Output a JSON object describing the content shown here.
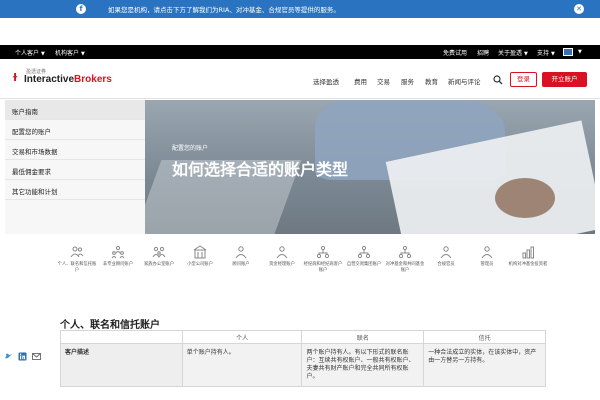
{
  "banner": {
    "icon": "ib-logo-icon",
    "text": "如果您是机构，请点击下方了解我们为RIA、对冲基金、合规官员等提供的服务。",
    "close_icon": "close-icon",
    "bg_color": "#2a73c0"
  },
  "utilbar": {
    "personal": "个人客户",
    "institutional": "机构客户",
    "free_trial": "免费试用",
    "careers": "招聘",
    "about": "关于盈透",
    "support": "支持"
  },
  "header": {
    "logo_sub": "盈透证券",
    "logo_prefix": "Interactive",
    "logo_suffix": "Brokers",
    "nav": [
      "选择盈透",
      "费用",
      "交易",
      "服务",
      "教育",
      "新闻与评论"
    ],
    "login": "登录",
    "open_account": "开立账户",
    "accent": "#d81222"
  },
  "sidebar": {
    "items": [
      "账户指南",
      "配置您的账户",
      "交易和市场数据",
      "最低佣金要求",
      "其它功能和计划"
    ]
  },
  "hero": {
    "eyebrow": "配置您的账户",
    "title": "如何选择合适的账户类型"
  },
  "account_types": [
    {
      "icon": "people-icon",
      "label": "个人、联名和信托账户"
    },
    {
      "icon": "group-icon",
      "label": "非专业顾问账户"
    },
    {
      "icon": "family-icon",
      "label": "家族办公室账户"
    },
    {
      "icon": "building-icon",
      "label": "小型公司账户"
    },
    {
      "icon": "person-icon",
      "label": "顾问账户"
    },
    {
      "icon": "person-icon",
      "label": "资金经理账户"
    },
    {
      "icon": "network-icon",
      "label": "经纪商和经纪商客户账户"
    },
    {
      "icon": "network-icon",
      "label": "自营交易集团账户"
    },
    {
      "icon": "network-icon",
      "label": "对冲基金和共同基金账户"
    },
    {
      "icon": "person-icon",
      "label": "合规官员"
    },
    {
      "icon": "person-icon",
      "label": "管理员"
    },
    {
      "icon": "bar-chart-icon",
      "label": "机构对冲基金投资者"
    }
  ],
  "section": {
    "title": "个人、联名和信托账户",
    "columns": [
      "",
      "个人",
      "联名",
      "信托"
    ],
    "rows": [
      [
        "客户描述",
        "单个账户持有人。",
        "两个账户持有人。有以下形式的联名账户：互续共有权账户、一般共有权账户、夫妻共有财产账户和完全共同所有权账户。",
        "一种合法成立的实体，在该实体中，资产由一方替另一方持有。"
      ]
    ]
  },
  "social": [
    "twitter-icon",
    "linkedin-icon",
    "email-icon"
  ]
}
